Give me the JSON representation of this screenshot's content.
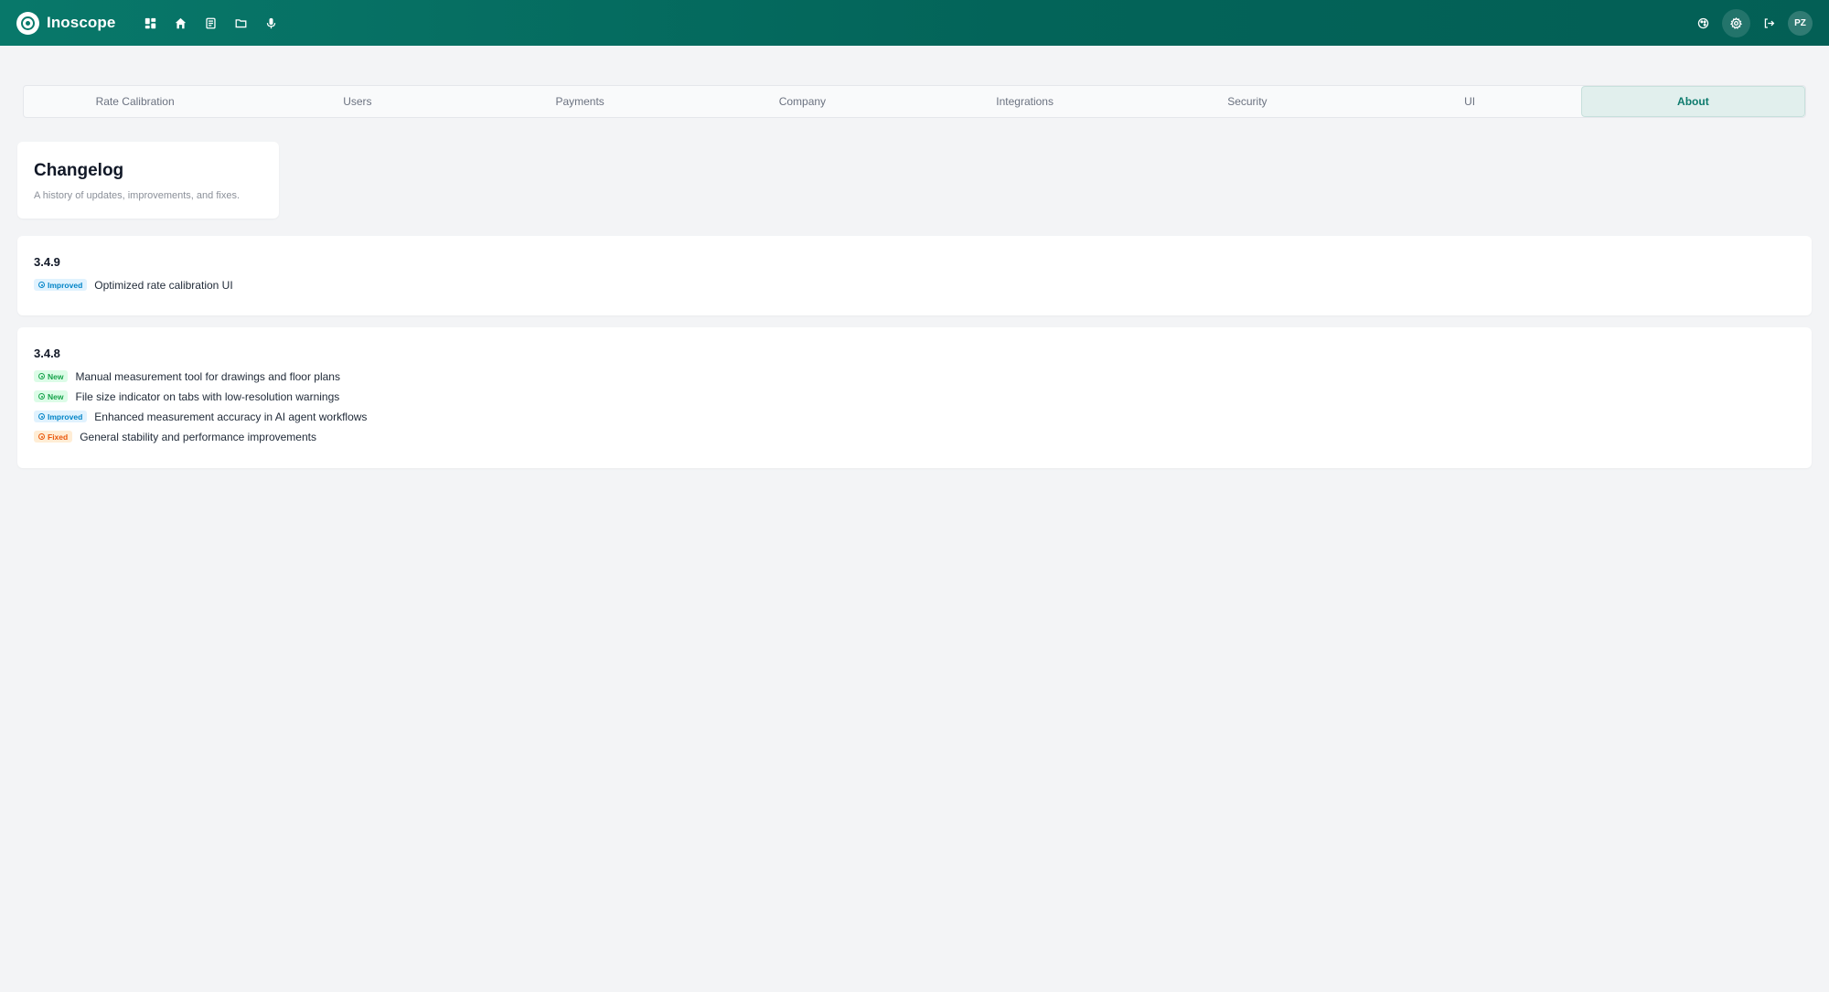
{
  "app": {
    "name": "Inoscope",
    "user_initials": "PZ"
  },
  "nav": {
    "icons": [
      "dashboard-icon",
      "home-icon",
      "document-icon",
      "folder-icon",
      "microphone-icon"
    ]
  },
  "tabs": [
    {
      "label": "Rate Calibration",
      "active": false
    },
    {
      "label": "Users",
      "active": false
    },
    {
      "label": "Payments",
      "active": false
    },
    {
      "label": "Company",
      "active": false
    },
    {
      "label": "Integrations",
      "active": false
    },
    {
      "label": "Security",
      "active": false
    },
    {
      "label": "UI",
      "active": false
    },
    {
      "label": "About",
      "active": true
    }
  ],
  "changelog": {
    "title": "Changelog",
    "subtitle": "A history of updates, improvements, and fixes."
  },
  "releases": [
    {
      "version": "3.4.9",
      "entries": [
        {
          "type": "Improved",
          "text": "Optimized rate calibration UI"
        }
      ]
    },
    {
      "version": "3.4.8",
      "entries": [
        {
          "type": "New",
          "text": "Manual measurement tool for drawings and floor plans"
        },
        {
          "type": "New",
          "text": "File size indicator on tabs with low-resolution warnings"
        },
        {
          "type": "Improved",
          "text": "Enhanced measurement accuracy in AI agent workflows"
        },
        {
          "type": "Fixed",
          "text": "General stability and performance improvements"
        }
      ]
    }
  ],
  "colors": {
    "header": "#036459",
    "accent": "#0d7a6d",
    "improved": "#0284c7",
    "new": "#16a34a",
    "fixed": "#ea580c"
  }
}
